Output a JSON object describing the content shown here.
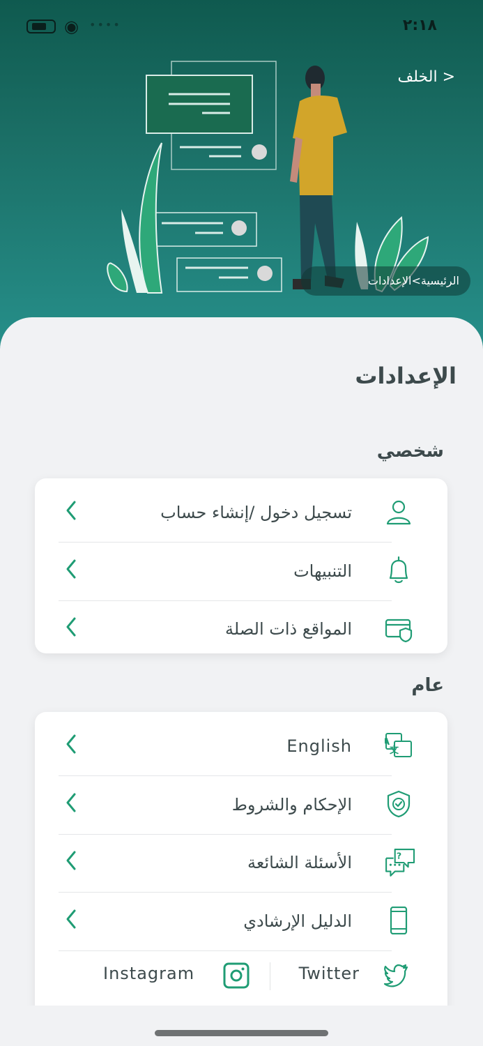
{
  "status_bar": {
    "time": "٢:١٨"
  },
  "header": {
    "back_label": "< الخلف",
    "breadcrumb": "الرئيسية>الإعدادات"
  },
  "page_title": "الإعدادات",
  "personal": {
    "title": "شخصي",
    "items": [
      {
        "label": "تسجيل دخول /إنشاء حساب",
        "icon": "user-icon"
      },
      {
        "label": "التنبيهات",
        "icon": "bell-icon"
      },
      {
        "label": "المواقع ذات الصلة",
        "icon": "card-shield-icon"
      }
    ]
  },
  "general": {
    "title": "عام",
    "items": [
      {
        "label": "English",
        "icon": "translate-icon"
      },
      {
        "label": "الإحكام والشروط",
        "icon": "shield-check-icon"
      },
      {
        "label": "الأسئلة الشائعة",
        "icon": "faq-chat-icon"
      },
      {
        "label": "الدليل الإرشادي",
        "icon": "mobile-guide-icon"
      }
    ],
    "social": {
      "twitter": "Twitter",
      "instagram": "Instagram"
    }
  },
  "colors": {
    "accent": "#1f9c74",
    "header_top": "#0f5a4f",
    "header_bottom": "#268f8a",
    "text": "#3d4a4c"
  }
}
